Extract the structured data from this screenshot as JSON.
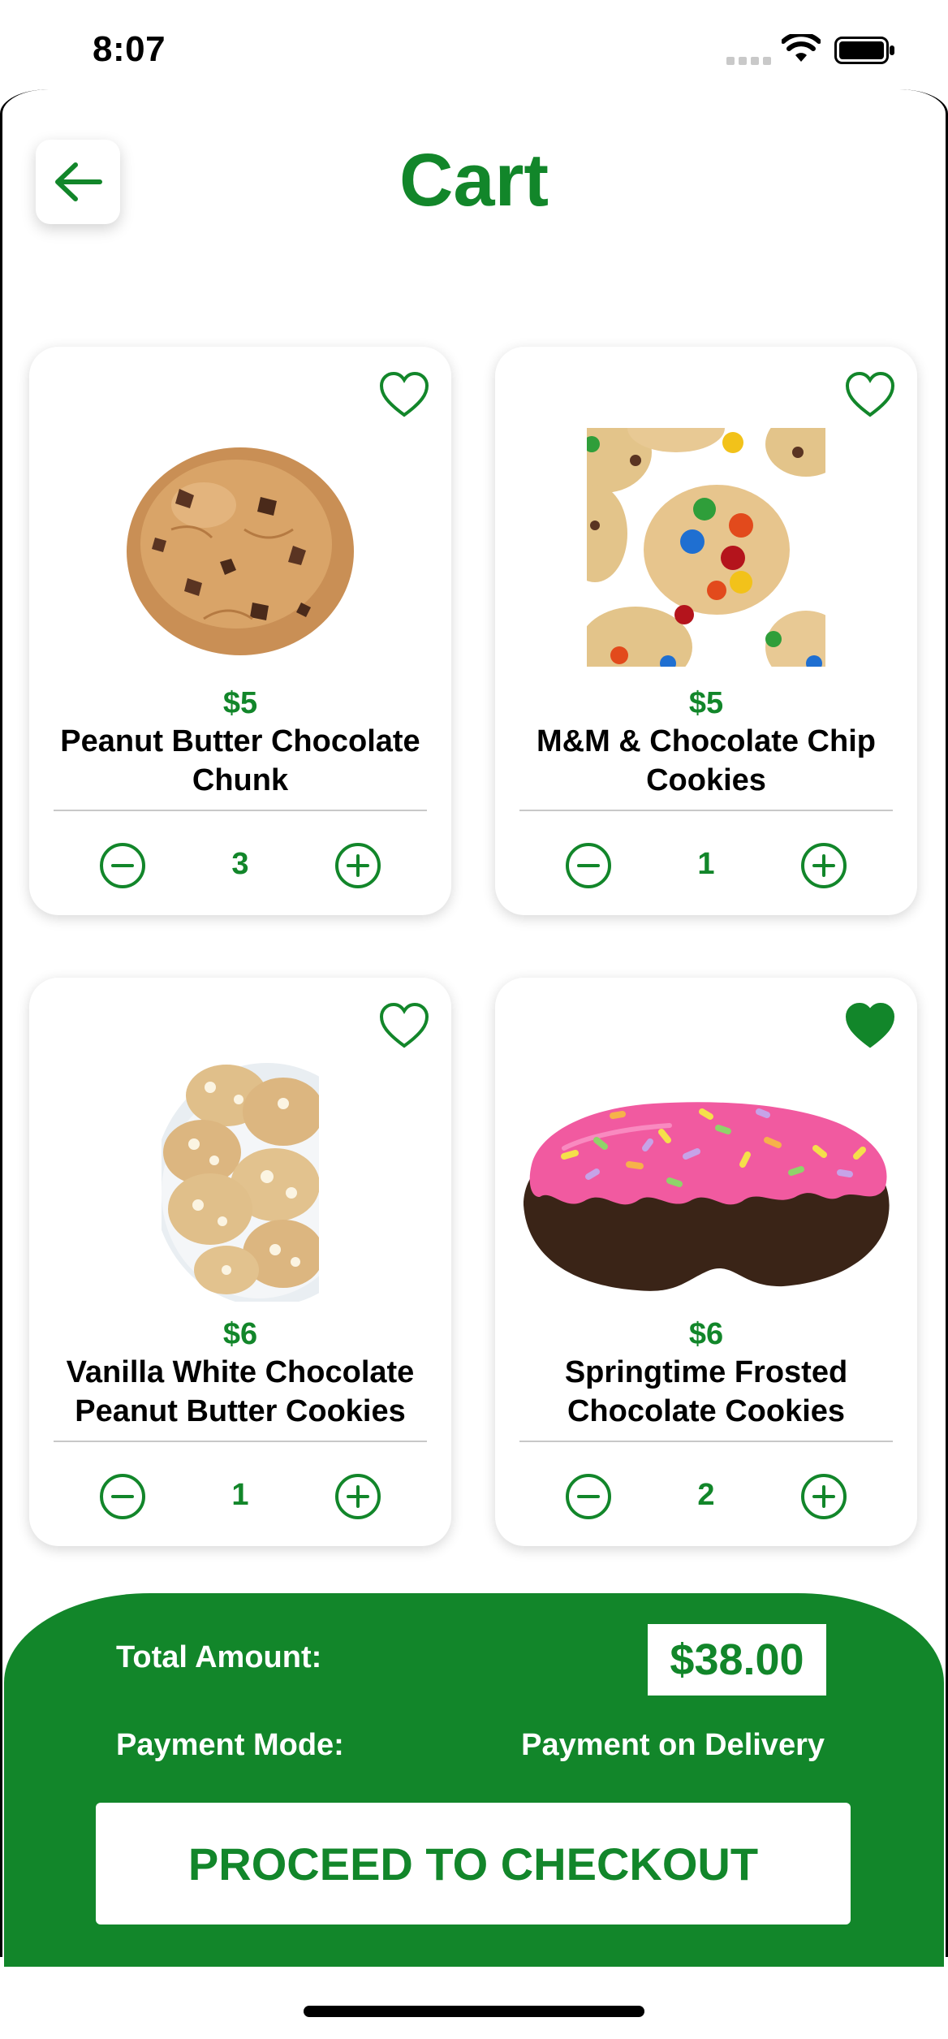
{
  "status_bar": {
    "time": "8:07"
  },
  "header": {
    "title": "Cart"
  },
  "colors": {
    "brand_green": "#12862a"
  },
  "cart": {
    "items": [
      {
        "price": "$5",
        "name": "Peanut Butter Chocolate Chunk",
        "quantity": "3",
        "favorite": false,
        "image": "chocolate-chunk-cookie"
      },
      {
        "price": "$5",
        "name": "M&M & Chocolate Chip Cookies",
        "quantity": "1",
        "favorite": false,
        "image": "mm-cookies"
      },
      {
        "price": "$6",
        "name": "Vanilla White Chocolate Peanut Butter Cookies",
        "quantity": "1",
        "favorite": false,
        "image": "white-chocolate-cookies-plate"
      },
      {
        "price": "$6",
        "name": "Springtime Frosted Chocolate Cookies",
        "quantity": "2",
        "favorite": true,
        "image": "frosted-sprinkle-cookie"
      }
    ]
  },
  "summary": {
    "total_label": "Total Amount:",
    "total_value": "$38.00",
    "payment_label": "Payment Mode:",
    "payment_value": "Payment on Delivery",
    "checkout_label": "PROCEED TO CHECKOUT"
  }
}
